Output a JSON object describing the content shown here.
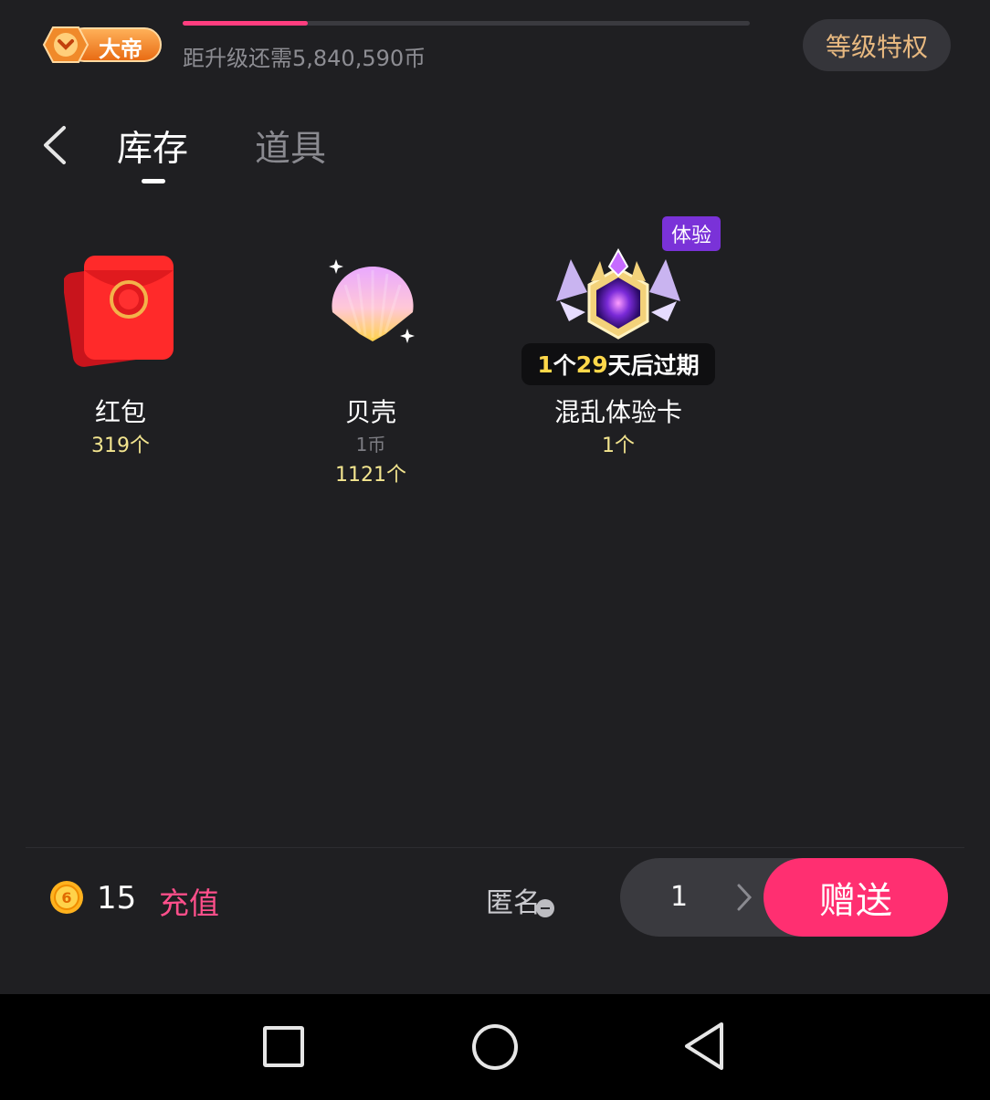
{
  "header": {
    "level_badge_label": "大帝",
    "upgrade_text": "距升级还需5,840,590币",
    "progress_fraction": 0.22,
    "privilege_button": "等级特权"
  },
  "tabs": [
    {
      "label": "库存",
      "active": true
    },
    {
      "label": "道具",
      "active": false
    }
  ],
  "items": [
    {
      "name": "红包",
      "count": "319个",
      "icon": "red-envelope-icon"
    },
    {
      "name": "贝壳",
      "price": "1币",
      "count": "1121个",
      "icon": "shell-icon"
    },
    {
      "name": "混乱体验卡",
      "count": "1个",
      "icon": "purple-crest-icon",
      "tag": "体验",
      "expire": {
        "count": "1",
        "count_unit": "个",
        "days": "29",
        "days_suffix": "天后过期"
      }
    }
  ],
  "footer": {
    "coin_balance": "15",
    "recharge_label": "充值",
    "anonymous_label": "匿名",
    "quantity": "1",
    "send_label": "赠送"
  },
  "colors": {
    "accent": "#ff2f71",
    "background": "#1f1f22",
    "count_text": "#f3e58f",
    "privilege_text": "#e8b980"
  },
  "nav_bar": [
    "square-recent-icon",
    "circle-home-icon",
    "triangle-back-icon"
  ]
}
